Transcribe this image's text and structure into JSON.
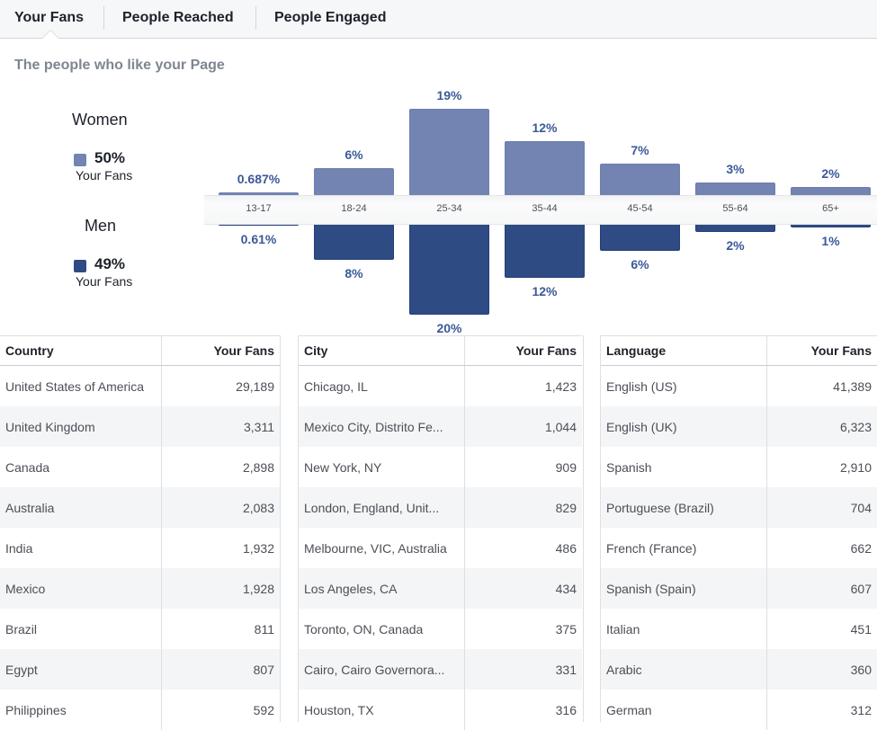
{
  "tabs": [
    {
      "label": "Your Fans",
      "active": true
    },
    {
      "label": "People Reached",
      "active": false
    },
    {
      "label": "People Engaged",
      "active": false
    }
  ],
  "subtitle": "The people who like your Page",
  "legend": {
    "women": {
      "title": "Women",
      "pct": "50%",
      "sub": "Your Fans",
      "color": "#7384b2"
    },
    "men": {
      "title": "Men",
      "pct": "49%",
      "sub": "Your Fans",
      "color": "#2f4b84"
    }
  },
  "chart_data": {
    "type": "bar",
    "title": "The people who like your Page",
    "xlabel": "",
    "ylabel": "",
    "categories": [
      "13-17",
      "18-24",
      "25-34",
      "35-44",
      "45-54",
      "55-64",
      "65+"
    ],
    "series": [
      {
        "name": "Women",
        "values": [
          0.687,
          6,
          19,
          12,
          7,
          3,
          2
        ],
        "labels": [
          "0.687%",
          "6%",
          "19%",
          "12%",
          "7%",
          "3%",
          "2%"
        ],
        "color": "#7384b2",
        "direction": "up"
      },
      {
        "name": "Men",
        "values": [
          0.61,
          8,
          20,
          12,
          6,
          2,
          1
        ],
        "labels": [
          "0.61%",
          "8%",
          "20%",
          "12%",
          "6%",
          "2%",
          "1%"
        ],
        "color": "#2f4b84",
        "direction": "down"
      }
    ],
    "grid": false,
    "legend": "left"
  },
  "tables": {
    "country": {
      "headers": [
        "Country",
        "Your Fans"
      ],
      "rows": [
        [
          "United States of America",
          "29,189"
        ],
        [
          "United Kingdom",
          "3,311"
        ],
        [
          "Canada",
          "2,898"
        ],
        [
          "Australia",
          "2,083"
        ],
        [
          "India",
          "1,932"
        ],
        [
          "Mexico",
          "1,928"
        ],
        [
          "Brazil",
          "811"
        ],
        [
          "Egypt",
          "807"
        ],
        [
          "Philippines",
          "592"
        ]
      ]
    },
    "city": {
      "headers": [
        "City",
        "Your Fans"
      ],
      "rows": [
        [
          "Chicago, IL",
          "1,423"
        ],
        [
          "Mexico City, Distrito Fe...",
          "1,044"
        ],
        [
          "New York, NY",
          "909"
        ],
        [
          "London, England, Unit...",
          "829"
        ],
        [
          "Melbourne, VIC, Australia",
          "486"
        ],
        [
          "Los Angeles, CA",
          "434"
        ],
        [
          "Toronto, ON, Canada",
          "375"
        ],
        [
          "Cairo, Cairo Governora...",
          "331"
        ],
        [
          "Houston, TX",
          "316"
        ]
      ]
    },
    "language": {
      "headers": [
        "Language",
        "Your Fans"
      ],
      "rows": [
        [
          "English (US)",
          "41,389"
        ],
        [
          "English (UK)",
          "6,323"
        ],
        [
          "Spanish",
          "2,910"
        ],
        [
          "Portuguese (Brazil)",
          "704"
        ],
        [
          "French (France)",
          "662"
        ],
        [
          "Spanish (Spain)",
          "607"
        ],
        [
          "Italian",
          "451"
        ],
        [
          "Arabic",
          "360"
        ],
        [
          "German",
          "312"
        ]
      ]
    }
  }
}
